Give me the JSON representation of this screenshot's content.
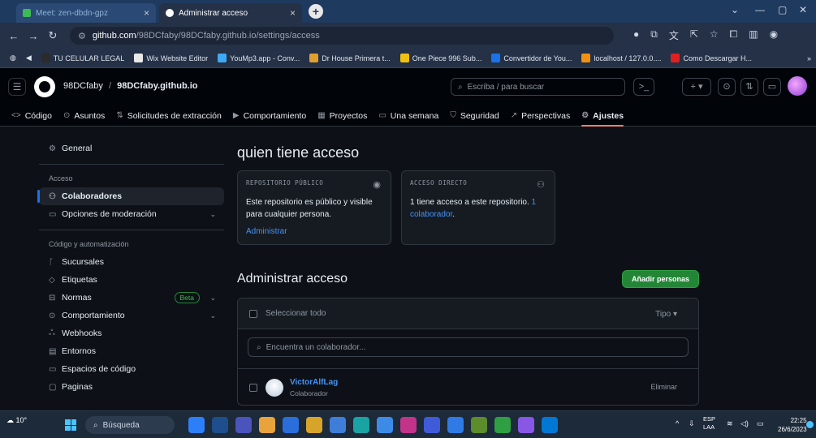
{
  "browser": {
    "tab_inactive": "Meet: zen-dbdn-gpz",
    "tab_active": "Administrar acceso",
    "tab_close": "×",
    "newtab": "+",
    "url_host": "github.com",
    "url_path": "/98DCfaby/98DCfaby.github.io/settings/access",
    "bookmarks": [
      {
        "label": "TU CELULAR LEGAL",
        "color": "#2b2b2b"
      },
      {
        "label": "Wix Website Editor",
        "color": "#e9e9e9"
      },
      {
        "label": "YouMp3.app - Conv...",
        "color": "#3fa9f5"
      },
      {
        "label": "Dr House Primera t...",
        "color": "#e0a030"
      },
      {
        "label": "One Piece 996 Sub...",
        "color": "#f0c010"
      },
      {
        "label": "Convertidor de You...",
        "color": "#1a73e8"
      },
      {
        "label": "localhost / 127.0.0....",
        "color": "#f29111"
      },
      {
        "label": "Como Descargar H...",
        "color": "#e02020"
      }
    ]
  },
  "header": {
    "owner": "98DCfaby",
    "separator": "/",
    "repo": "98DCfaby.github.io",
    "search_placeholder": "Escriba / para buscar",
    "tabs": [
      {
        "label": "Código",
        "icon": "<>"
      },
      {
        "label": "Asuntos",
        "icon": "⊙"
      },
      {
        "label": "Solicitudes de extracción",
        "icon": "⇅"
      },
      {
        "label": "Comportamiento",
        "icon": "▶"
      },
      {
        "label": "Proyectos",
        "icon": "▦"
      },
      {
        "label": "Una semana",
        "icon": "▭"
      },
      {
        "label": "Seguridad",
        "icon": "⛉"
      },
      {
        "label": "Perspectivas",
        "icon": "↗"
      },
      {
        "label": "Ajustes",
        "icon": "⚙"
      }
    ]
  },
  "sidebar": {
    "general": "General",
    "section_access": "Acceso",
    "colaboradores": "Colaboradores",
    "moderacion": "Opciones de moderación",
    "section_code": "Código y automatización",
    "sucursales": "Sucursales",
    "etiquetas": "Etiquetas",
    "normas": "Normas",
    "beta": "Beta",
    "comportamiento": "Comportamiento",
    "webhooks": "Webhooks",
    "entornos": "Entornos",
    "espacios": "Espacios de código",
    "paginas": "Paginas"
  },
  "main": {
    "title": "quien tiene acceso",
    "card_public": {
      "caption": "REPOSITORIO PÚBLICO",
      "text": "Este repositorio es público y visible para cualquier persona.",
      "link": "Administrar"
    },
    "card_direct": {
      "caption": "ACCESO DIRECTO",
      "text_a": "1 tiene acceso a este repositorio.",
      "link": "1 colaborador",
      "text_b": "."
    },
    "manage_title": "Administrar acceso",
    "add_button": "Añadir personas",
    "select_all": "Seleccionar todo",
    "type_filter": "Tipo ▾",
    "filter_placeholder": "Encuentra un colaborador...",
    "collaborator": {
      "name": "VictorAlfLag",
      "role": "Colaborador",
      "remove": "Eliminar"
    }
  },
  "taskbar": {
    "weather": "10°",
    "search": "Búsqueda",
    "lang": "ESP",
    "lang2": "LAA",
    "time": "22:25",
    "date": "26/6/2023",
    "apps": [
      "#2d7ff9",
      "#1e4e8c",
      "#4b53bc",
      "#e8a33d",
      "#2a6edb",
      "#d7a42a",
      "#3f7ed8",
      "#19a3a3",
      "#3c8ce7",
      "#c2338a",
      "#3f5bd8",
      "#2f7ae5",
      "#5c8c2c",
      "#2ea043",
      "#8957e5",
      "#0078d4"
    ]
  }
}
